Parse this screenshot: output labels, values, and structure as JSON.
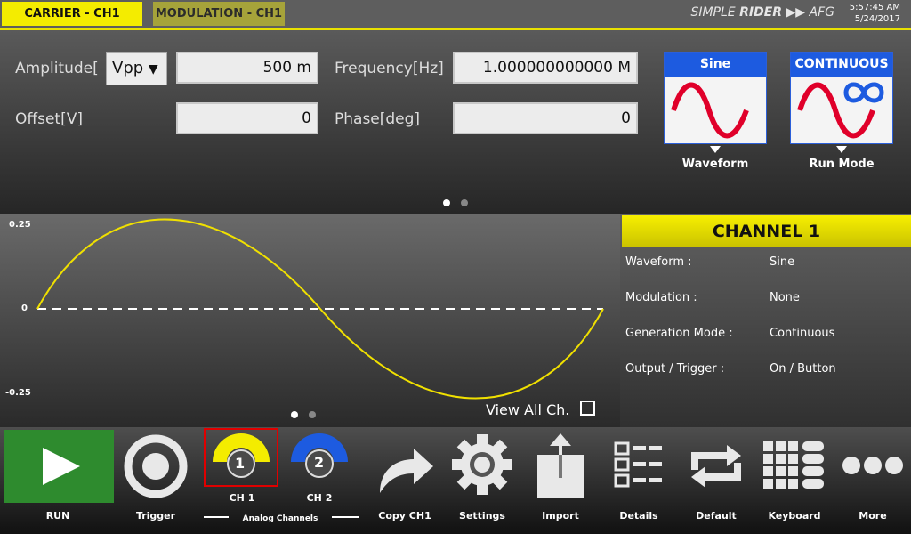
{
  "tabs": {
    "carrier": "CARRIER - CH1",
    "modulation": "MODULATION - CH1"
  },
  "brand": {
    "simple": "SIMPLE",
    "rider": "RIDER",
    "afg": "AFG"
  },
  "clock": {
    "time": "5:57:45 AM",
    "date": "5/24/2017"
  },
  "params": {
    "amplitude_label": "Amplitude[",
    "amplitude_unit": "Vpp",
    "amplitude_value": "500 m",
    "offset_label": "Offset[V]",
    "offset_value": "0",
    "frequency_label": "Frequency[Hz]",
    "frequency_value": "1.000000000000 M",
    "phase_label": "Phase[deg]",
    "phase_value": "0"
  },
  "waveform_tile": {
    "header": "Sine",
    "caption": "Waveform"
  },
  "runmode_tile": {
    "header": "CONTINUOUS",
    "caption": "Run Mode"
  },
  "graph": {
    "ymax": "0.25",
    "yzero": "0",
    "ymin": "-0.25",
    "view_all": "View All Ch."
  },
  "channel_info": {
    "title": "CHANNEL 1",
    "rows": [
      {
        "key": "Waveform :",
        "value": "Sine"
      },
      {
        "key": "Modulation :",
        "value": "None"
      },
      {
        "key": "Generation Mode :",
        "value": "Continuous"
      },
      {
        "key": "Output / Trigger :",
        "value": "On / Button"
      }
    ]
  },
  "toolbar": {
    "run": "RUN",
    "trigger": "Trigger",
    "ch1": "CH 1",
    "ch2": "CH 2",
    "ch1_num": "1",
    "ch2_num": "2",
    "analog": "Analog Channels",
    "copy": "Copy CH1",
    "settings": "Settings",
    "import": "Import",
    "details": "Details",
    "default": "Default",
    "keyboard": "Keyboard",
    "more": "More"
  },
  "colors": {
    "accent": "#f4ec00",
    "blue": "#1d5be0",
    "red": "#e0002a",
    "run_green": "#2e8b2e"
  }
}
